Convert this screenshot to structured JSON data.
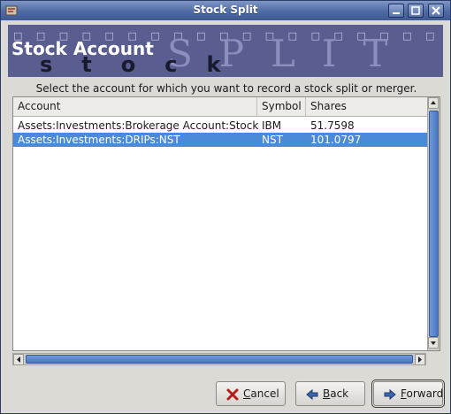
{
  "window": {
    "title": "Stock Split"
  },
  "banner": {
    "heading": "Stock Account",
    "decor_squares": "□ □ □ □ □ □ □ □ □ □ □ □ □ □ □ □ □ □ □ □ □",
    "decor_stock": "stock",
    "decor_split": "SPLIT"
  },
  "instruction": "Select the account for which you want to record a stock split or merger.",
  "table": {
    "columns": [
      "Account",
      "Symbol",
      "Shares"
    ],
    "rows": [
      {
        "account": "Assets:Investments:Brokerage Account:Stock:IBM",
        "symbol": "IBM",
        "shares": "51.7598",
        "selected": false
      },
      {
        "account": "Assets:Investments:DRIPs:NST",
        "symbol": "NST",
        "shares": "101.0797",
        "selected": true
      }
    ]
  },
  "buttons": {
    "cancel": {
      "pre": "",
      "mnemonic": "C",
      "post": "ancel",
      "icon": "x-cancel-icon"
    },
    "back": {
      "pre": "",
      "mnemonic": "B",
      "post": "ack",
      "icon": "arrow-left-icon"
    },
    "forward": {
      "pre": "",
      "mnemonic": "F",
      "post": "orward",
      "icon": "arrow-right-icon"
    }
  },
  "colors": {
    "title_bar": "#4f6aa4",
    "banner": "#5a5d8f",
    "selection": "#4b8ad6"
  }
}
